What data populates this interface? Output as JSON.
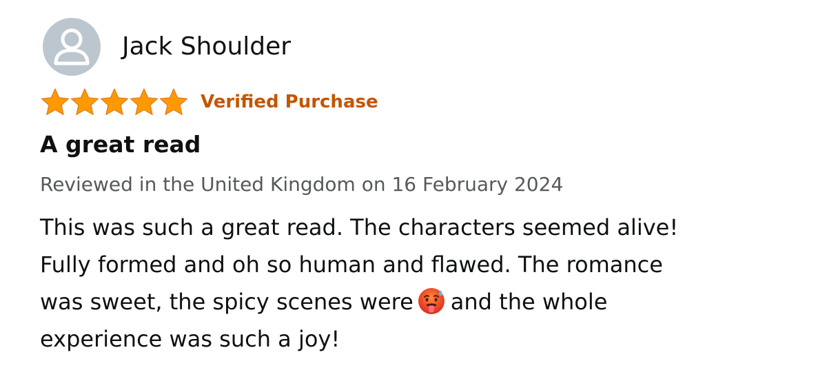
{
  "reviewer": {
    "name": "Jack Shoulder",
    "avatar_icon": "default-user-icon"
  },
  "rating": {
    "stars": 5,
    "max_stars": 5,
    "star_color": "#ff9900",
    "verified_label": "Verified Purchase",
    "verified_color": "#c45500"
  },
  "review": {
    "title": "A great read",
    "meta": "Reviewed in the United Kingdom on 16 February 2024",
    "body_lines": [
      "This was such a great read. The characters seemed alive!",
      "Fully formed and oh so human and flawed. The romance",
      "was sweet, the spicy scenes were",
      "and the whole",
      "experience was such a joy!"
    ],
    "inline_emoji": "hot-face-emoji"
  }
}
